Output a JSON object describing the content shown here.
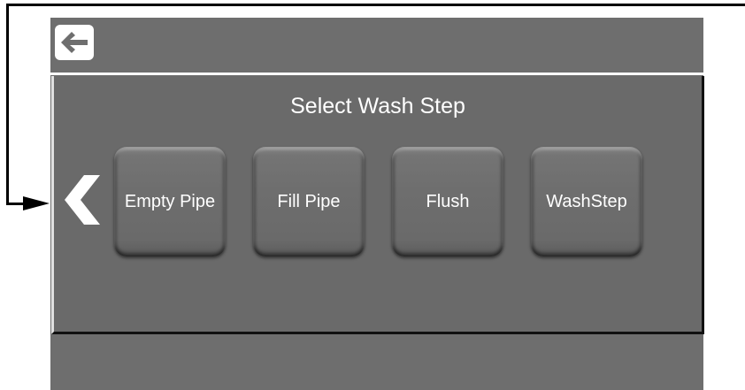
{
  "header": {
    "back_icon": "arrow-left-icon"
  },
  "panel": {
    "title": "Select Wash Step",
    "nav_prev_icon": "chevron-left-icon",
    "steps": [
      {
        "label": "Empty Pipe"
      },
      {
        "label": "Fill Pipe"
      },
      {
        "label": "Flush"
      },
      {
        "label": "WashStep"
      }
    ]
  },
  "colors": {
    "screen_bg": "#6e6e6e",
    "text": "#ffffff",
    "annotation": "#000000"
  }
}
